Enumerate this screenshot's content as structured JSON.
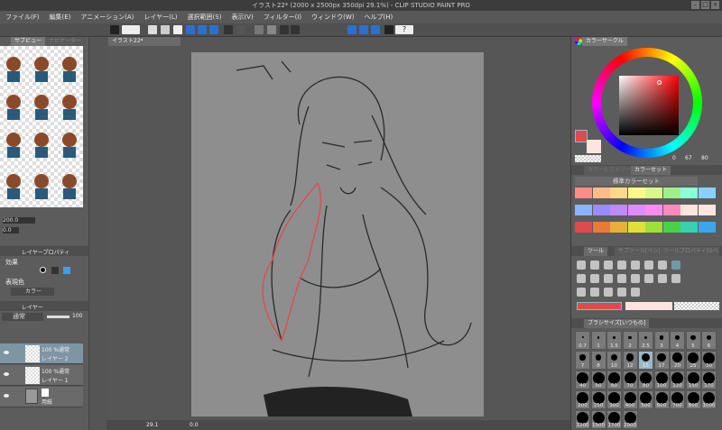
{
  "window": {
    "title": "イラスト22* (2000 x 2500px 350dpi 29.1%) - CLIP STUDIO PAINT PRO"
  },
  "menu": [
    "ファイル(F)",
    "編集(E)",
    "アニメーション(A)",
    "レイヤー(L)",
    "選択範囲(S)",
    "表示(V)",
    "フィルター(I)",
    "ウィンドウ(W)",
    "ヘルプ(H)"
  ],
  "left": {
    "tabs": {
      "subview": "サブビュー",
      "navigator": "ナビゲーター"
    },
    "nav": {
      "zoom": "200.0",
      "rotate": "0.0"
    },
    "layer_property": {
      "tab": "レイヤープロパティ",
      "effect_label": "効果",
      "expression_color_label": "表現色",
      "expression_color_value": "カラー"
    },
    "layers": {
      "tab": "レイヤー",
      "blend_mode": "通常",
      "opacity": "100",
      "items": [
        {
          "mode": "100 %通常",
          "name": "レイヤー 2",
          "selected": true
        },
        {
          "mode": "100 %通常",
          "name": "レイヤー 1",
          "selected": false
        },
        {
          "mode": "",
          "name": "用紙",
          "selected": false
        }
      ]
    }
  },
  "canvas": {
    "tab": "イラスト22*",
    "zoom": "29.1",
    "rotation": "0.0"
  },
  "right": {
    "color_circle": {
      "tab": "カラーサークル",
      "h": "0",
      "s": "67",
      "v": "80",
      "main_color": "#e04a4a",
      "sub_color": "#fde4dc"
    },
    "color_set": {
      "tabs": [
        "カラーヒストリー",
        "カラーセット"
      ],
      "name": "標準カラーセット",
      "colors": [
        "#ff8a8a",
        "#ffbb8a",
        "#ffd88a",
        "#fdf88a",
        "#d8f88a",
        "#a0f08a",
        "#8affd8",
        "#8ad0ff",
        "#8ab4ff",
        "#9c8aff",
        "#c08aff",
        "#e08aff",
        "#ff8af0",
        "#ff8ac0",
        "#fde4dc",
        "#fde4dc",
        "#e04a4a",
        "#e87a3a",
        "#e8b03a",
        "#e0e03a",
        "#9ce03a",
        "#4ad04a",
        "#3ad0b0",
        "#3aa8e8"
      ]
    },
    "tool": {
      "tabs": [
        "ツール",
        "サブツール[ペン]",
        "ツールプロパティ[Gペン]"
      ],
      "main_color": "#e04a4a",
      "sub_color": "#fde4dc"
    },
    "brush_size": {
      "tab": "ブラシサイズ[いつもの]",
      "selected": "15",
      "sizes": [
        "0.7",
        "1",
        "1.5",
        "2",
        "2.5",
        "3",
        "4",
        "5",
        "6",
        "7",
        "8",
        "10",
        "12",
        "15",
        "17",
        "20",
        "25",
        "30",
        "40",
        "50",
        "60",
        "70",
        "80",
        "100",
        "120",
        "150",
        "170",
        "200",
        "250",
        "300",
        "400",
        "500",
        "600",
        "700",
        "800",
        "1000",
        "1200",
        "1500",
        "1700",
        "2000"
      ]
    }
  }
}
